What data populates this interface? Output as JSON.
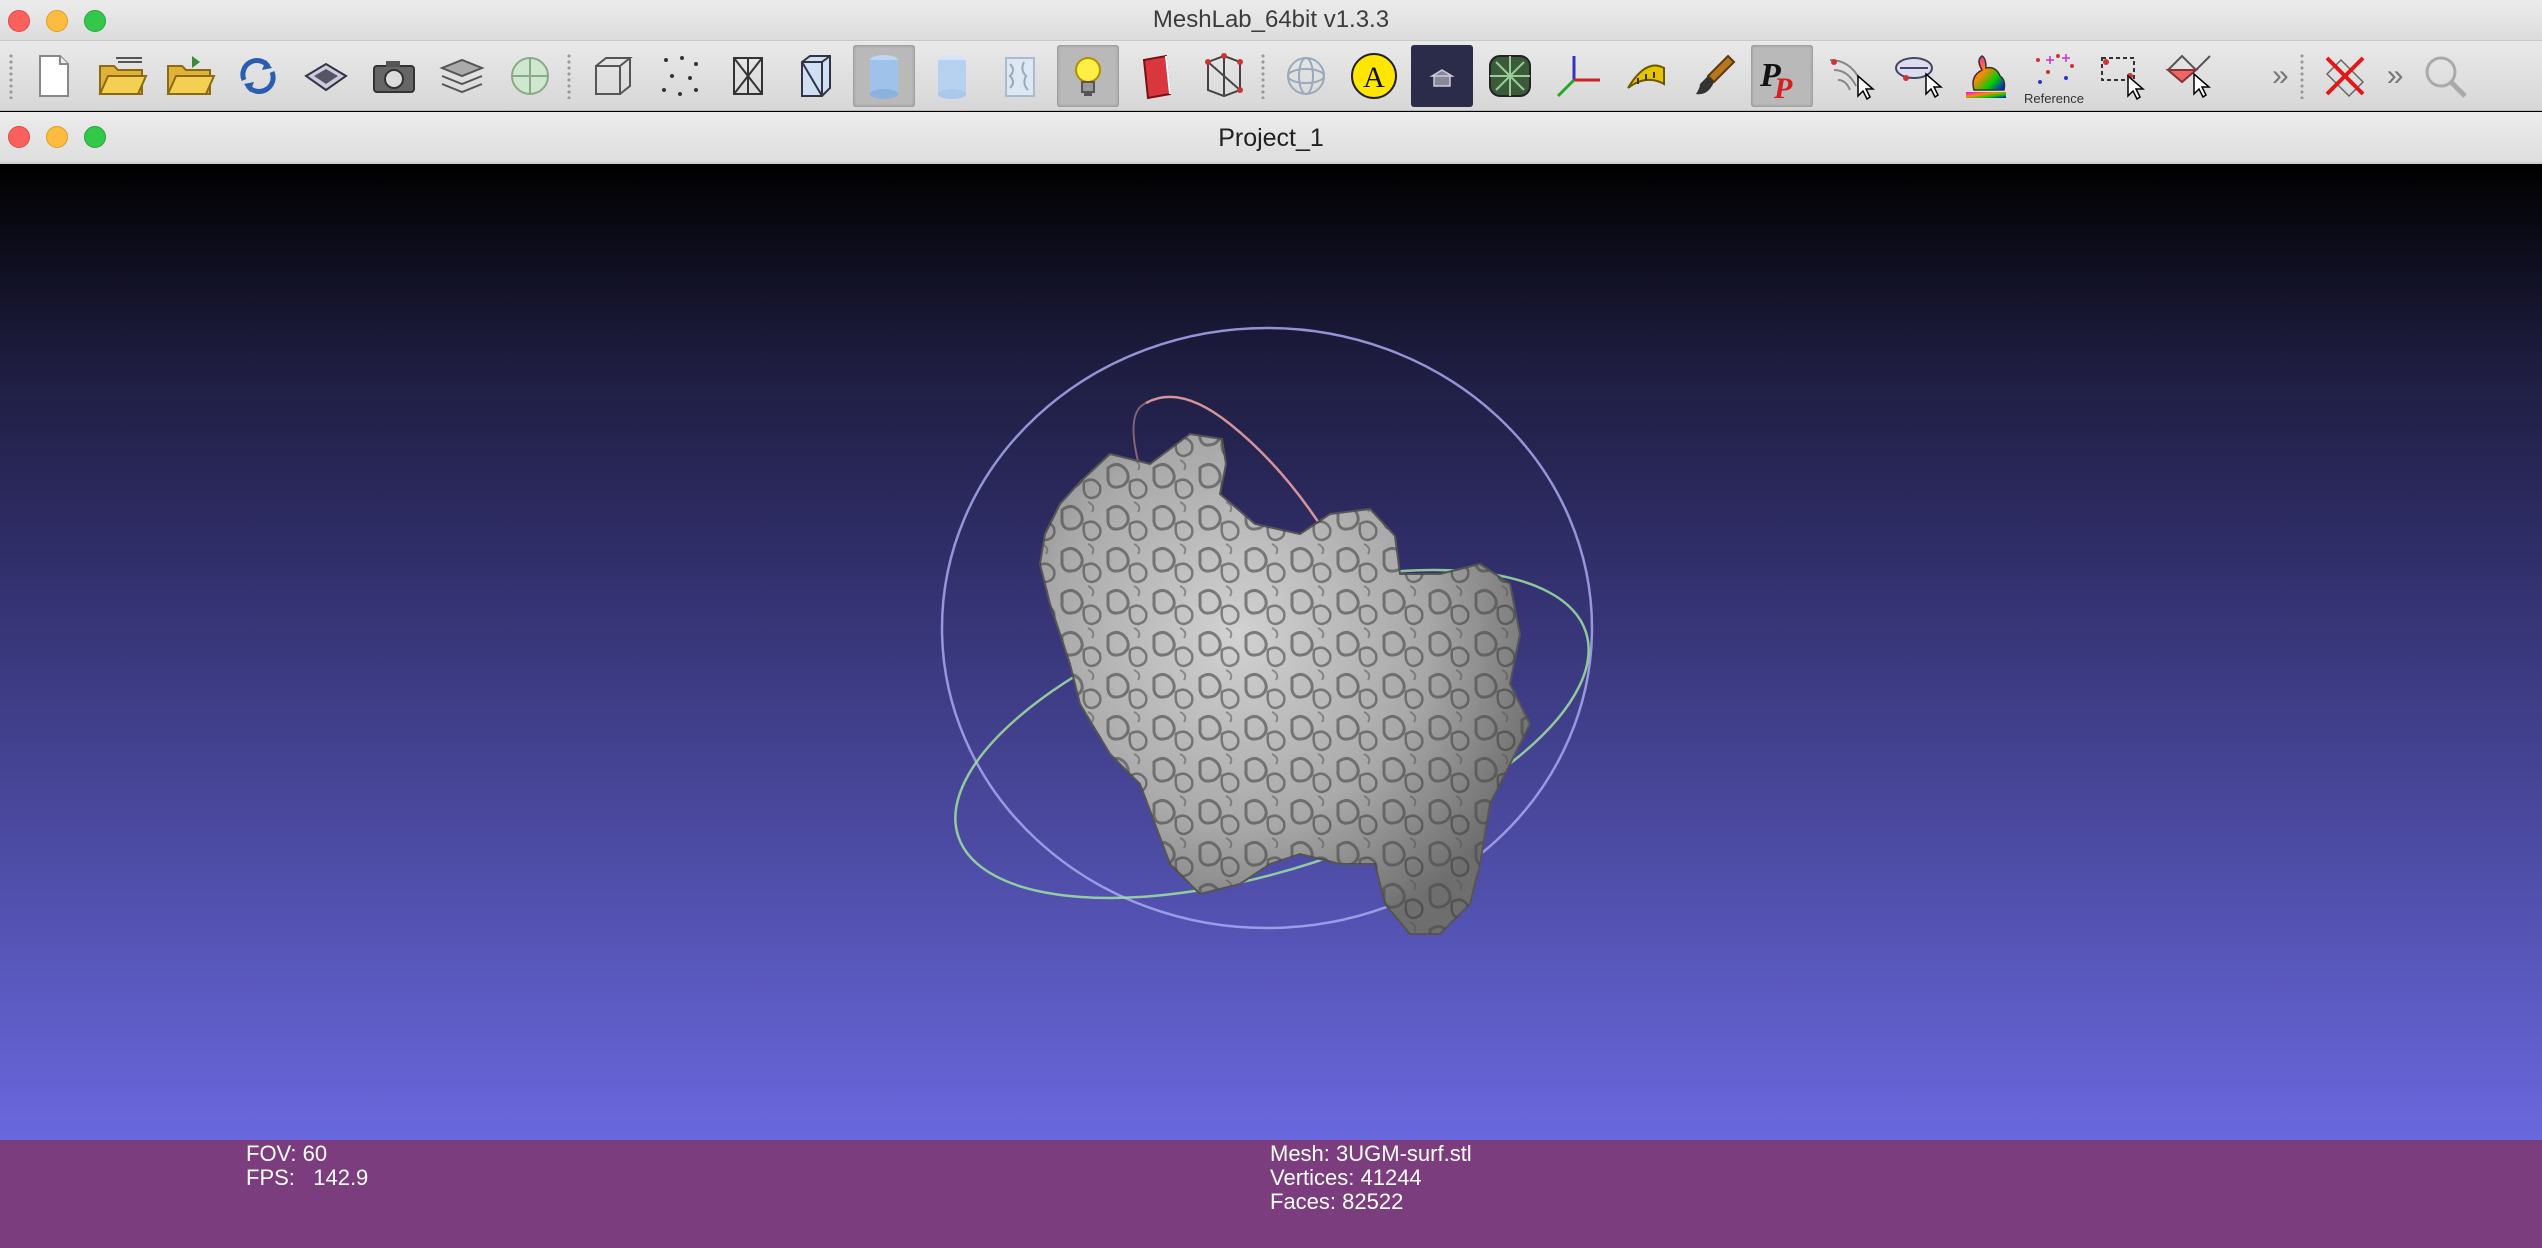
{
  "window": {
    "title": "MeshLab_64bit v1.3.3"
  },
  "toolbar": {
    "buttons": [
      {
        "name": "new-project-icon"
      },
      {
        "name": "open-project-icon"
      },
      {
        "name": "import-mesh-icon"
      },
      {
        "name": "reload-icon"
      },
      {
        "name": "save-icon"
      },
      {
        "name": "snapshot-icon"
      },
      {
        "name": "layers-icon"
      },
      {
        "name": "raster-icon"
      },
      {
        "name": "bounding-box-icon"
      },
      {
        "name": "points-icon"
      },
      {
        "name": "wireframe-icon"
      },
      {
        "name": "hidden-lines-icon"
      },
      {
        "name": "flat-lines-icon"
      },
      {
        "name": "flat-icon"
      },
      {
        "name": "smooth-icon"
      },
      {
        "name": "texture-icon"
      },
      {
        "name": "light-icon"
      },
      {
        "name": "backface-icon"
      },
      {
        "name": "selected-faces-icon"
      },
      {
        "name": "trackball-icon"
      },
      {
        "name": "annotation-icon"
      },
      {
        "name": "background-icon"
      },
      {
        "name": "fill-icon"
      },
      {
        "name": "axis-icon"
      },
      {
        "name": "measure-icon"
      },
      {
        "name": "paint-brush-icon"
      },
      {
        "name": "pp-icon"
      },
      {
        "name": "point-picker-icon"
      },
      {
        "name": "align-icon"
      },
      {
        "name": "color-bunny-icon"
      },
      {
        "name": "reference-icon",
        "label": "Reference"
      },
      {
        "name": "select-vertices-icon"
      },
      {
        "name": "select-faces-icon"
      }
    ],
    "more_label": "»",
    "tools": [
      {
        "name": "delete-icon"
      },
      {
        "name": "zoom-icon"
      }
    ]
  },
  "project": {
    "title": "Project_1"
  },
  "viewport": {
    "background_top": "#000000",
    "background_bottom": "#6a68de"
  },
  "info": {
    "fov": "FOV: 60",
    "fps": "FPS:   142.9",
    "mesh": "Mesh: 3UGM-surf.stl",
    "vertices": "Vertices: 41244",
    "faces": "Faces: 82522"
  },
  "colors": {
    "info_bar": "#7c3d7e",
    "trackball_red": "#e8a0a0",
    "trackball_green": "#a0e0a0",
    "trackball_blue": "#a8a8f0"
  }
}
